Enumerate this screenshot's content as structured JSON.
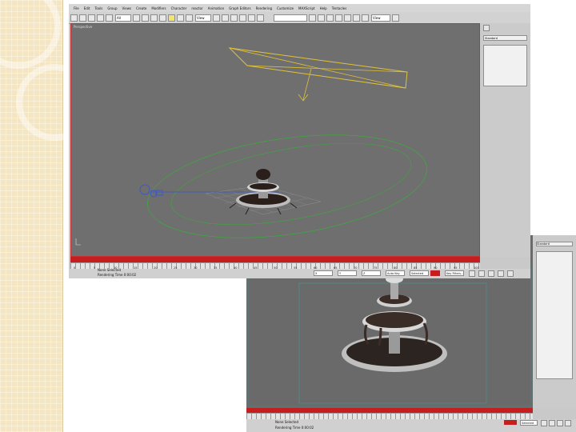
{
  "app": {
    "menu": [
      "File",
      "Edit",
      "Tools",
      "Group",
      "Views",
      "Create",
      "Modifiers",
      "Character",
      "reactor",
      "Animation",
      "Graph Editors",
      "Rendering",
      "Customize",
      "MAXScript",
      "Help",
      "Tentacles"
    ],
    "selection_filter": "All",
    "reference_coord": "View",
    "render_preset": "View"
  },
  "top_window": {
    "viewport_label": "Perspective",
    "timeline_ticks": [
      "0",
      "5",
      "10",
      "15",
      "20",
      "25",
      "30",
      "35",
      "40",
      "45",
      "50",
      "55",
      "60",
      "65",
      "70",
      "75",
      "80",
      "85",
      "90",
      "95",
      "100"
    ],
    "status_line1": "None Selected",
    "status_line2": "Rendering Time 0:00:02",
    "coord_x": "X",
    "coord_y": "Y",
    "coord_z": "Z",
    "autokey_label": "Auto Key",
    "selected_label": "Selected",
    "setkey_label": "Set Key",
    "keyfilters_label": "Key Filters...",
    "cmd_dropdown": "Standard"
  },
  "bottom_window": {
    "cmd_dropdown": "Standard",
    "status_line1": "None Selected",
    "status_line2": "Rendering Time 0:00:02",
    "autokey_label": "Auto Key",
    "selected_label": "Selected"
  },
  "colors": {
    "viewport_bg": "#6f6f6f",
    "timeslider": "#c61e1e",
    "spotlight": "#e0c23a",
    "camera": "#3a59c8",
    "green_path": "#3fa83f",
    "fountain_dark": "#2a1f1a"
  }
}
